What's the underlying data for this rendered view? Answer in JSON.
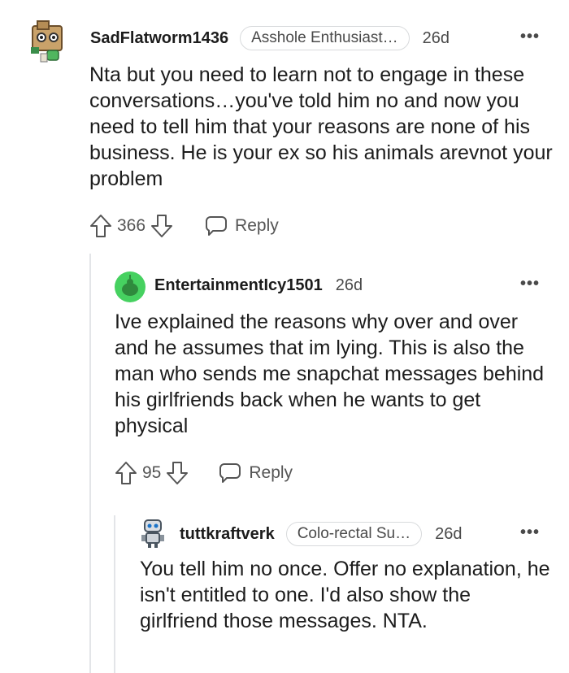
{
  "comments": [
    {
      "username": "SadFlatworm1436",
      "flair": "Asshole Enthusiast…",
      "age": "26d",
      "avatar_icon": "robot-box-avatar-icon",
      "body": "Nta but you need to learn not to engage in these conversations…you've told him no and now you need to tell him that your reasons are none of his business. He is your ex so his animals arevnot your problem",
      "votes": "366",
      "reply_label": "Reply"
    },
    {
      "username": "EntertainmentIcy1501",
      "flair": "",
      "age": "26d",
      "avatar_icon": "green-snoo-avatar-icon",
      "body": "Ive explained the reasons why over and over and he assumes that im lying. This is also the man who sends me snapchat messages behind his girlfriends back when he wants to get physical",
      "votes": "95",
      "reply_label": "Reply"
    },
    {
      "username": "tuttkraftverk",
      "flair": "Colo-rectal Su…",
      "age": "26d",
      "avatar_icon": "robot-avatar-icon",
      "body": "You tell him no once. Offer no explanation, he isn't entitled to one. I'd also show the girlfriend those messages. NTA."
    }
  ],
  "more_options": "•••",
  "colors": {
    "text": "#1c1c1c",
    "muted": "#4a4a4a",
    "thread_line": "#e3e5e8",
    "snoo_green": "#46d160"
  }
}
